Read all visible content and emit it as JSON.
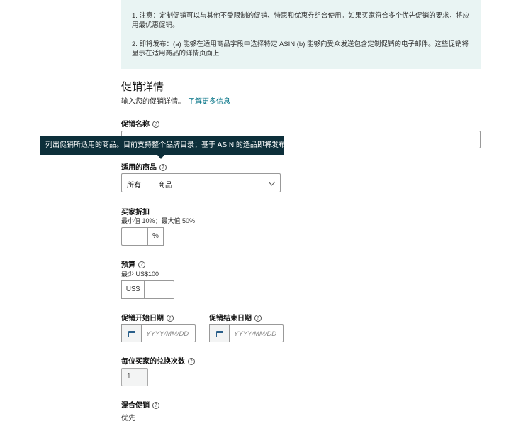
{
  "notice": {
    "item1": "1. 注意：定制促销可以与其他不受限制的促销、特惠和优惠券组合使用。如果买家符合多个优先促销的要求，将应用最优惠促销。",
    "item2": "2. 即将发布：(a) 能够在适用商品字段中选择特定 ASIN (b) 能够向受众发送包含定制促销的电子邮件。这些促销将显示在适用商品的详情页面上"
  },
  "details": {
    "title": "促销详情",
    "description": "输入您的促销详情。",
    "learn_more": "了解更多信息"
  },
  "promotion_name": {
    "label": "促销名称",
    "value": ""
  },
  "tooltip": {
    "text": "列出促销所适用的商品。目前支持整个品牌目录；基于 ASIN 的选品即将发布"
  },
  "applicable_products": {
    "label": "适用的商品",
    "prefix": "所有",
    "suffix": "商品"
  },
  "buyer_discount": {
    "label": "买家折扣",
    "hint": "最小值 10%；最大值 50%",
    "unit": "%",
    "value": ""
  },
  "budget": {
    "label": "预算",
    "hint": "最少 US$100",
    "currency": "US$",
    "value": ""
  },
  "start_date": {
    "label": "促销开始日期",
    "placeholder": "YYYY/MM/DD"
  },
  "end_date": {
    "label": "促销结束日期",
    "placeholder": "YYYY/MM/DD"
  },
  "redemptions": {
    "label": "每位买家的兑换次数",
    "value": "1"
  },
  "combined": {
    "label": "混合促销",
    "value": "优先"
  },
  "icons": {
    "help": "help-circle-icon",
    "calendar": "calendar-icon",
    "dropdown": "chevron-down-icon"
  }
}
